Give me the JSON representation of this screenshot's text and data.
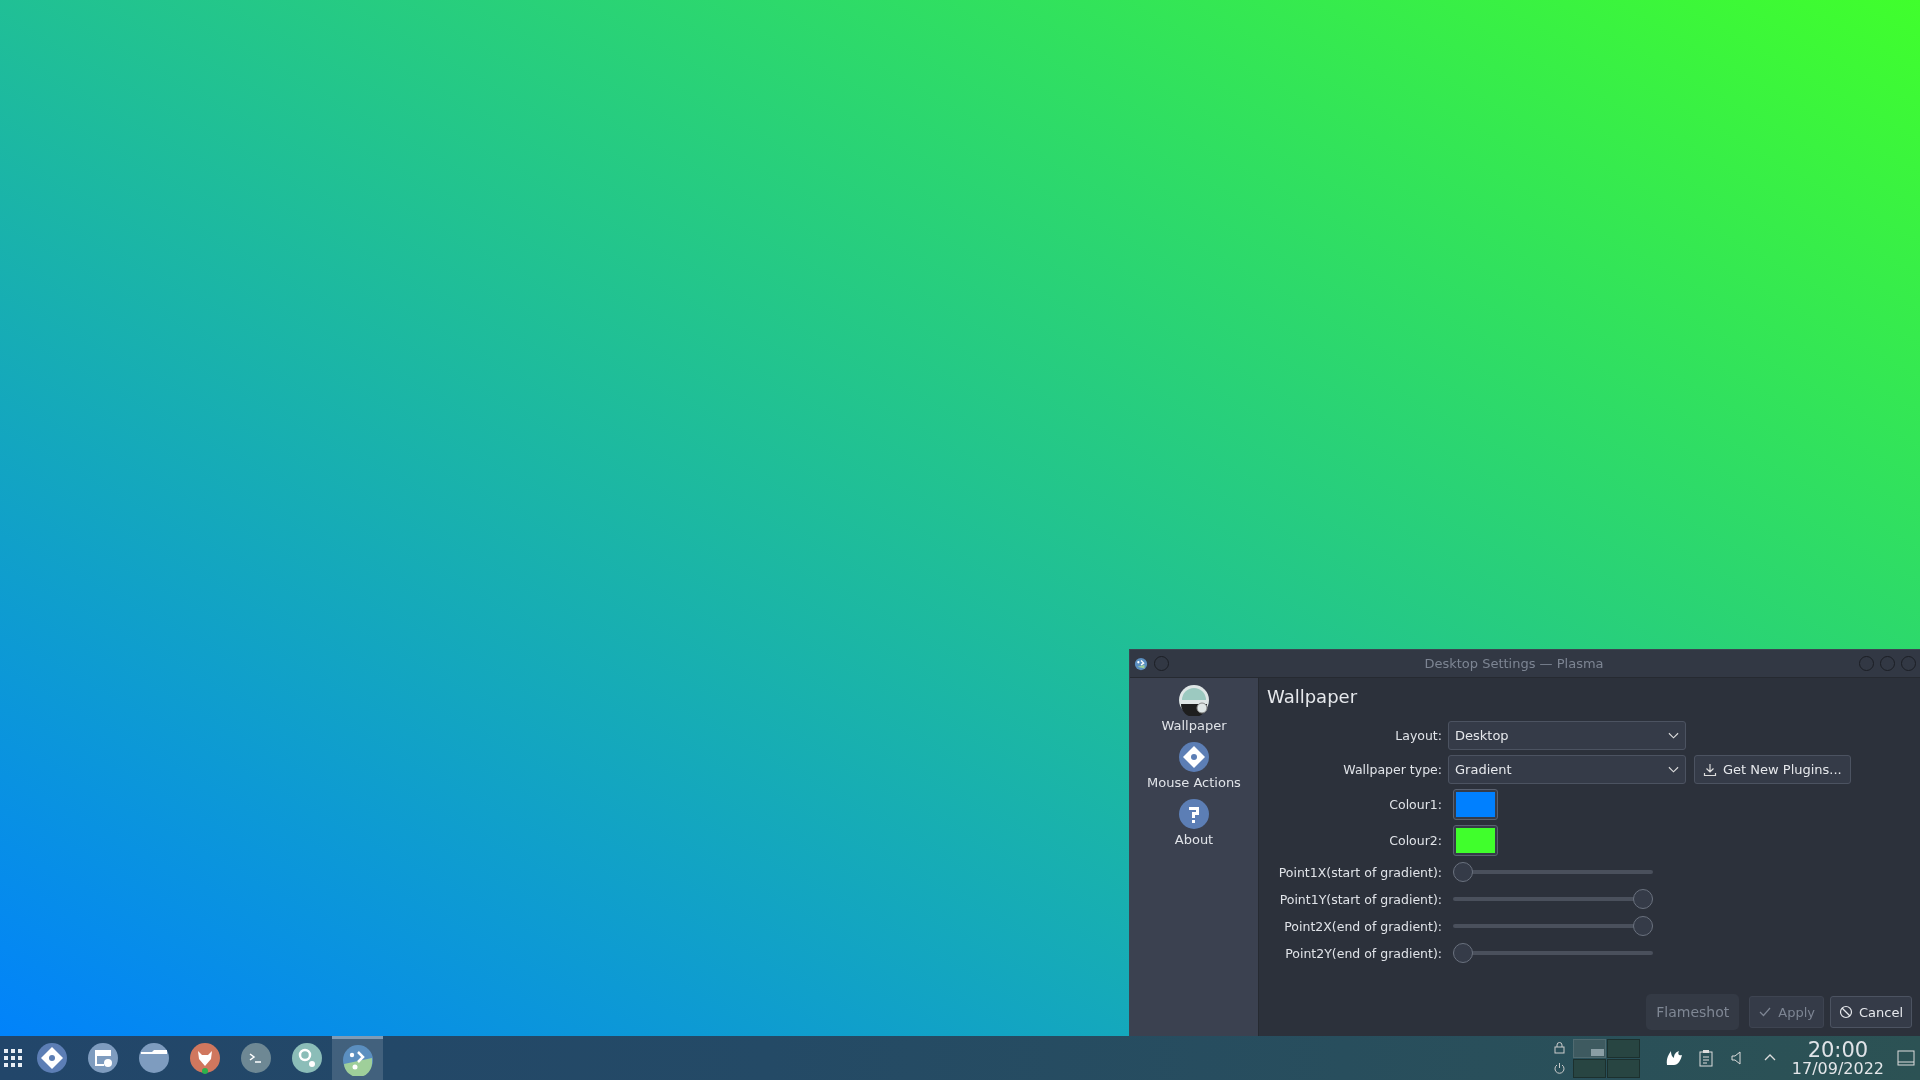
{
  "dialog": {
    "title": "Desktop Settings — Plasma",
    "sidebar": [
      {
        "label": "Wallpaper"
      },
      {
        "label": "Mouse Actions"
      },
      {
        "label": "About"
      }
    ],
    "heading": "Wallpaper",
    "form": [
      {
        "kind": "dropdown",
        "label": "Layout:",
        "value": "Desktop"
      },
      {
        "kind": "dropdown",
        "label": "Wallpaper type:",
        "value": "Gradient",
        "button": "Get New Plugins..."
      },
      {
        "kind": "colour",
        "label": "Colour1:",
        "color": "#0080ff"
      },
      {
        "kind": "colour",
        "label": "Colour2:",
        "color": "#40ff2c"
      },
      {
        "kind": "slider",
        "label": "Point1X(start of gradient):",
        "level": 0
      },
      {
        "kind": "slider",
        "label": "Point1Y(start of gradient):",
        "level": 1
      },
      {
        "kind": "slider",
        "label": "Point2X(end of gradient):",
        "level": 1
      },
      {
        "kind": "slider",
        "label": "Point2Y(end of gradient):",
        "level": 0
      }
    ],
    "tooltip": "Flameshot",
    "buttons": [
      {
        "label": "Apply",
        "kind": "apply",
        "disabled": true
      },
      {
        "label": "Cancel",
        "kind": "cancel",
        "disabled": false
      }
    ]
  },
  "taskbar": {
    "tasks": [
      {
        "active": false
      },
      {
        "active": false
      },
      {
        "active": false
      },
      {
        "active": false
      },
      {
        "active": false
      },
      {
        "active": false
      },
      {
        "active": true
      }
    ],
    "pager": [
      {
        "selected": true
      },
      {
        "selected": false
      },
      {
        "selected": false
      },
      {
        "selected": false
      }
    ],
    "time": "20:00",
    "date": "17/09/2022"
  }
}
